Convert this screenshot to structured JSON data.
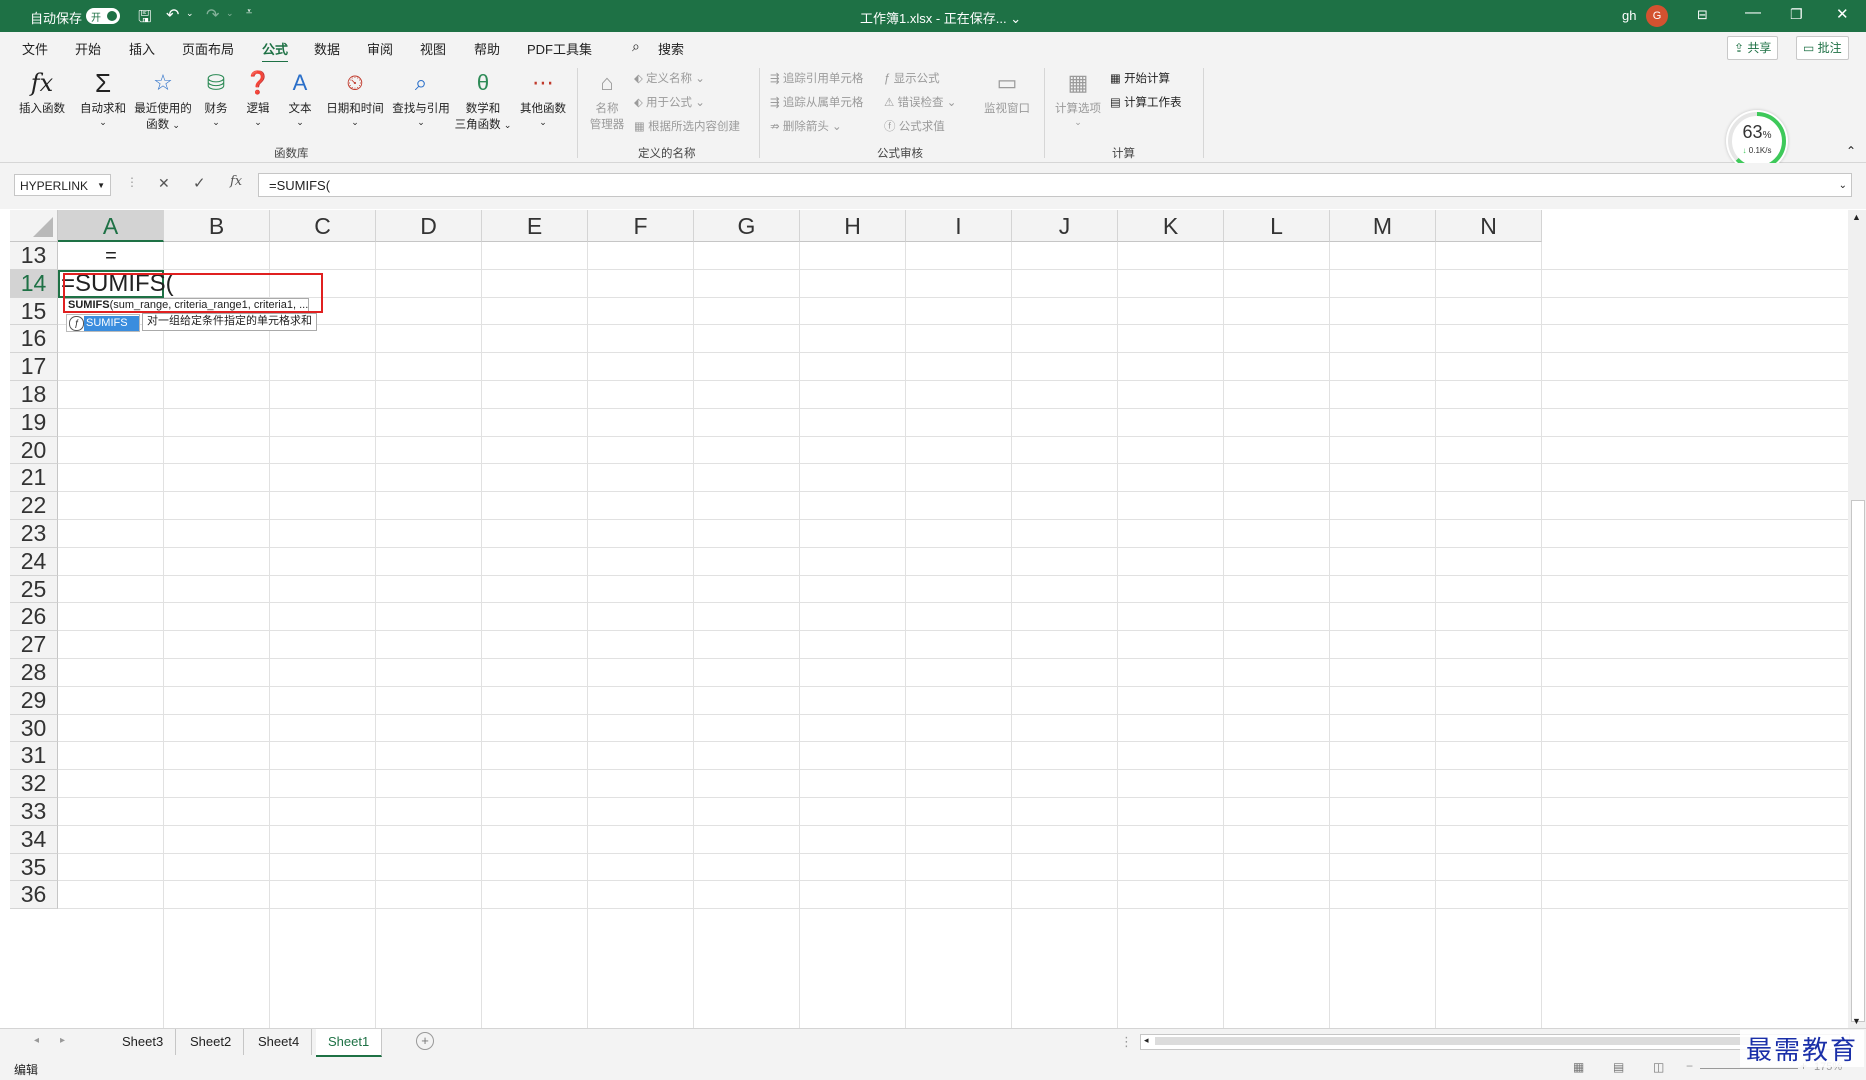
{
  "titlebar": {
    "autosave_label": "自动保存",
    "autosave_state": "开",
    "document_title": "工作簿1.xlsx - 正在保存... ⌄",
    "user": "gh",
    "avatar_initial": "G"
  },
  "menu": {
    "items": [
      "文件",
      "开始",
      "插入",
      "页面布局",
      "公式",
      "数据",
      "审阅",
      "视图",
      "帮助",
      "PDF工具集"
    ],
    "active": "公式",
    "search": "搜索",
    "share": "共享",
    "comments": "批注"
  },
  "ribbon": {
    "insert_function": "插入函数",
    "autosum": "自动求和",
    "recent_line1": "最近使用的",
    "recent_line2": "函数",
    "financial": "财务",
    "logical": "逻辑",
    "text": "文本",
    "datetime": "日期和时间",
    "lookup": "查找与引用",
    "math_line1": "数学和",
    "math_line2": "三角函数",
    "more": "其他函数",
    "group_function_library": "函数库",
    "name_manager_line1": "名称",
    "name_manager_line2": "管理器",
    "define_name": "定义名称",
    "use_in_formula": "用于公式",
    "create_from_selection": "根据所选内容创建",
    "group_defined_names": "定义的名称",
    "trace_precedents": "追踪引用单元格",
    "trace_dependents": "追踪从属单元格",
    "remove_arrows": "删除箭头",
    "show_formulas": "显示公式",
    "error_checking": "错误检查",
    "evaluate_formula": "公式求值",
    "group_formula_auditing": "公式审核",
    "watch_window": "监视窗口",
    "calc_options": "计算选项",
    "calc_now": "开始计算",
    "calc_sheet": "计算工作表",
    "group_calculation": "计算"
  },
  "gauge": {
    "percent": "63",
    "percent_sign": "%",
    "speed": "0.1K/s",
    "value": 0.63
  },
  "formula_bar": {
    "name_box": "HYPERLINK",
    "cancel": "✕",
    "enter": "✓",
    "fx": "fx",
    "formula": "=SUMIFS("
  },
  "grid": {
    "columns": [
      "A",
      "B",
      "C",
      "D",
      "E",
      "F",
      "G",
      "H",
      "I",
      "J",
      "K",
      "L",
      "M",
      "N"
    ],
    "rows": [
      "13",
      "14",
      "15",
      "16",
      "17",
      "18",
      "19",
      "20",
      "21",
      "22",
      "23",
      "24",
      "25",
      "26",
      "27",
      "28",
      "29",
      "30",
      "31",
      "32",
      "33",
      "34",
      "35",
      "36"
    ],
    "cell_a13": "=",
    "cell_a14": "=SUMIFS(",
    "tooltip_fn": "SUMIFS",
    "tooltip_args": "(sum_range, criteria_range1, criteria1, ...)",
    "autocomplete_item": "SUMIFS",
    "autocomplete_desc": "对一组给定条件指定的单元格求和"
  },
  "sheets": {
    "tabs": [
      "Sheet3",
      "Sheet2",
      "Sheet4",
      "Sheet1"
    ],
    "active": "Sheet1"
  },
  "status": {
    "mode": "编辑",
    "zoom": "175%"
  },
  "watermark": "最需教育"
}
